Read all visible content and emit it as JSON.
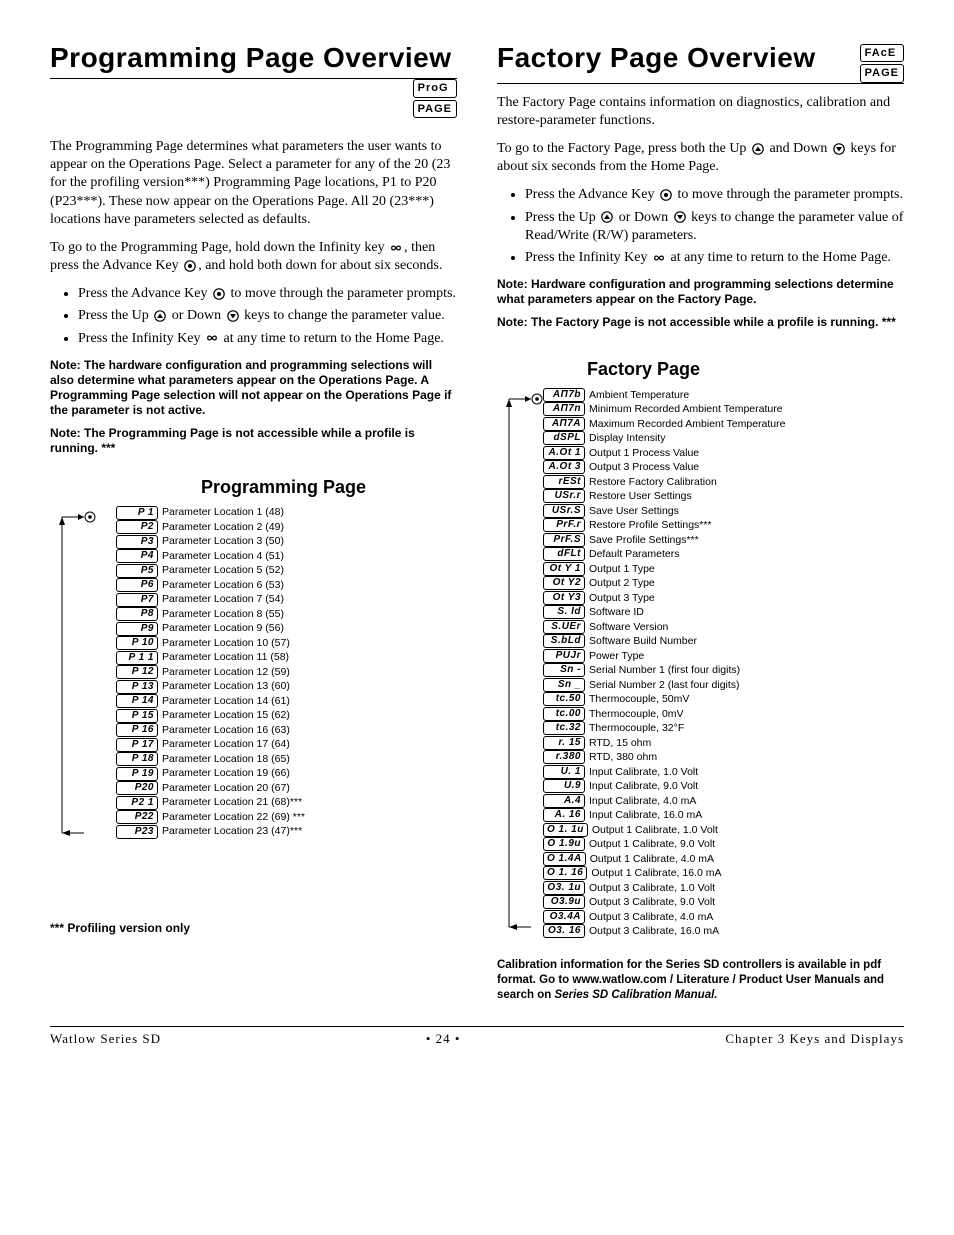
{
  "left": {
    "title": "Programming Page Overview",
    "code1": "ProG",
    "code2": "PAGE",
    "intro": "The Programming Page determines what parameters the user wants to appear on the Operations Page. Select a parameter for any of the 20 (23 for the profiling version***) Programming Page locations, P1 to P20 (P23***). These now appear on the Operations Page. All 20 (23***) locations have parameters selected as defaults.",
    "goto": "To go to the Programming Page, hold down the Infinity key ",
    "goto2": ", then press the Advance Key ",
    "goto3": ", and hold both down for about six seconds.",
    "b1a": "Press the Advance Key ",
    "b1b": " to move through the parameter prompts.",
    "b2a": "Press the Up ",
    "b2b": " or Down ",
    "b2c": " keys to change the parameter value.",
    "b3a": "Press the Infinity Key ",
    "b3b": " at any time to return to the Home Page.",
    "note1": "Note: The hardware configuration and programming selections will also determine what parameters appear on the Operations Page. A Programming Page selection will not appear on the Operations Page if the parameter is not active.",
    "note2": "Note: The Programming Page is not accessible while a profile is running. ***",
    "sectionTitle": "Programming Page",
    "params": [
      {
        "c": "P  1",
        "l": "Parameter Location 1 (48)"
      },
      {
        "c": "P2",
        "l": "Parameter Location 2 (49)"
      },
      {
        "c": "P3",
        "l": "Parameter Location 3 (50)"
      },
      {
        "c": "P4",
        "l": "Parameter Location 4 (51)"
      },
      {
        "c": "P5",
        "l": "Parameter Location 5 (52)"
      },
      {
        "c": "P6",
        "l": "Parameter Location 6 (53)"
      },
      {
        "c": "P7",
        "l": "Parameter Location 7 (54)"
      },
      {
        "c": "P8",
        "l": "Parameter Location 8 (55)"
      },
      {
        "c": "P9",
        "l": "Parameter Location 9 (56)"
      },
      {
        "c": "P 10",
        "l": "Parameter Location 10 (57)"
      },
      {
        "c": "P 1 1",
        "l": "Parameter Location 11 (58)"
      },
      {
        "c": "P 12",
        "l": "Parameter Location 12 (59)"
      },
      {
        "c": "P 13",
        "l": "Parameter Location 13 (60)"
      },
      {
        "c": "P 14",
        "l": "Parameter Location 14 (61)"
      },
      {
        "c": "P 15",
        "l": "Parameter Location 15 (62)"
      },
      {
        "c": "P 16",
        "l": "Parameter Location 16 (63)"
      },
      {
        "c": "P 17",
        "l": "Parameter Location 17 (64)"
      },
      {
        "c": "P 18",
        "l": "Parameter Location 18 (65)"
      },
      {
        "c": "P 19",
        "l": "Parameter Location 19 (66)"
      },
      {
        "c": "P20",
        "l": "Parameter Location 20 (67)"
      },
      {
        "c": "P2 1",
        "l": "Parameter Location 21 (68)***"
      },
      {
        "c": "P22",
        "l": "Parameter Location 22 (69) ***"
      },
      {
        "c": "P23",
        "l": "Parameter Location 23 (47)***"
      }
    ],
    "profNote": "*** Profiling version only"
  },
  "right": {
    "title": "Factory Page Overview",
    "code1": "FAcE",
    "code2": "PAGE",
    "intro": "The Factory Page contains information on diagnostics, calibration and restore-parameter functions.",
    "goto1": "To go to the Factory Page, press both the Up ",
    "goto2": " and Down ",
    "goto3": " keys for about six seconds from the Home Page.",
    "b1a": "Press the Advance Key ",
    "b1b": " to move through the parameter prompts.",
    "b2a": "Press the Up ",
    "b2b": " or Down ",
    "b2c": " keys to change the parameter value of Read/Write (R/W) parameters.",
    "b3a": "Press the Infinity Key ",
    "b3b": " at any time to return to the Home Page.",
    "note1": "Note: Hardware configuration and programming selections determine what parameters appear on the Factory Page.",
    "note2": "Note: The Factory Page is not accessible while a profile is running. ***",
    "sectionTitle": "Factory Page",
    "params": [
      {
        "c": "AΠ7b",
        "l": "Ambient Temperature"
      },
      {
        "c": "AΠ7n",
        "l": "Minimum Recorded Ambient Temperature"
      },
      {
        "c": "AΠ7A",
        "l": "Maximum Recorded Ambient Temperature"
      },
      {
        "c": "dSPL",
        "l": "Display Intensity"
      },
      {
        "c": "A.Ot 1",
        "l": "Output 1 Process Value"
      },
      {
        "c": "A.Ot 3",
        "l": "Output 3 Process Value"
      },
      {
        "c": "rESt",
        "l": "Restore Factory Calibration"
      },
      {
        "c": "USr.r",
        "l": "Restore User Settings"
      },
      {
        "c": "USr.S",
        "l": "Save User Settings"
      },
      {
        "c": "PrF.r",
        "l": "Restore Profile Settings***"
      },
      {
        "c": "PrF.S",
        "l": "Save Profile Settings***"
      },
      {
        "c": "dFLt",
        "l": "Default Parameters"
      },
      {
        "c": "Ot Y 1",
        "l": "Output 1 Type"
      },
      {
        "c": "Ot Y2",
        "l": "Output 2 Type"
      },
      {
        "c": "Ot Y3",
        "l": "Output 3 Type"
      },
      {
        "c": "S. Id",
        "l": "Software ID"
      },
      {
        "c": "S.UEr",
        "l": "Software Version"
      },
      {
        "c": "S.bLd",
        "l": "Software Build Number"
      },
      {
        "c": "PUJr",
        "l": "Power Type"
      },
      {
        "c": "Sn -",
        "l": "Serial Number 1 (first four digits)"
      },
      {
        "c": "Sn _",
        "l": "Serial Number 2 (last four digits)"
      },
      {
        "c": "tc.50",
        "l": "Thermocouple, 50mV"
      },
      {
        "c": "tc.00",
        "l": "Thermocouple, 0mV"
      },
      {
        "c": "tc.32",
        "l": "Thermocouple, 32°F"
      },
      {
        "c": "r. 15",
        "l": "RTD, 15 ohm"
      },
      {
        "c": "r.380",
        "l": "RTD, 380 ohm"
      },
      {
        "c": "U. 1",
        "l": "Input Calibrate, 1.0 Volt"
      },
      {
        "c": "U.9",
        "l": "Input Calibrate, 9.0 Volt"
      },
      {
        "c": "A.4",
        "l": "Input Calibrate, 4.0 mA"
      },
      {
        "c": "A. 16",
        "l": "Input Calibrate, 16.0 mA"
      },
      {
        "c": "O 1. 1u",
        "l": "Output 1 Calibrate, 1.0 Volt"
      },
      {
        "c": "O 1.9u",
        "l": "Output 1 Calibrate, 9.0 Volt"
      },
      {
        "c": "O 1.4A",
        "l": "Output 1 Calibrate, 4.0 mA"
      },
      {
        "c": "O 1. 16",
        "l": "Output 1 Calibrate, 16.0 mA"
      },
      {
        "c": "O3. 1u",
        "l": "Output 3 Calibrate, 1.0 Volt"
      },
      {
        "c": "O3.9u",
        "l": "Output 3 Calibrate, 9.0 Volt"
      },
      {
        "c": "O3.4A",
        "l": "Output 3 Calibrate, 4.0 mA"
      },
      {
        "c": "O3. 16",
        "l": "Output 3 Calibrate, 16.0 mA"
      }
    ],
    "calibNote1": "Calibration information for the Series SD controllers is available in pdf format. Go to www.watlow.com / Literature / Product User Manuals and search on ",
    "calibNote2": "Series SD Calibration Manual."
  },
  "footer": {
    "left": "Watlow Series SD",
    "center": "• 24 •",
    "right": "Chapter 3 Keys and Displays"
  }
}
